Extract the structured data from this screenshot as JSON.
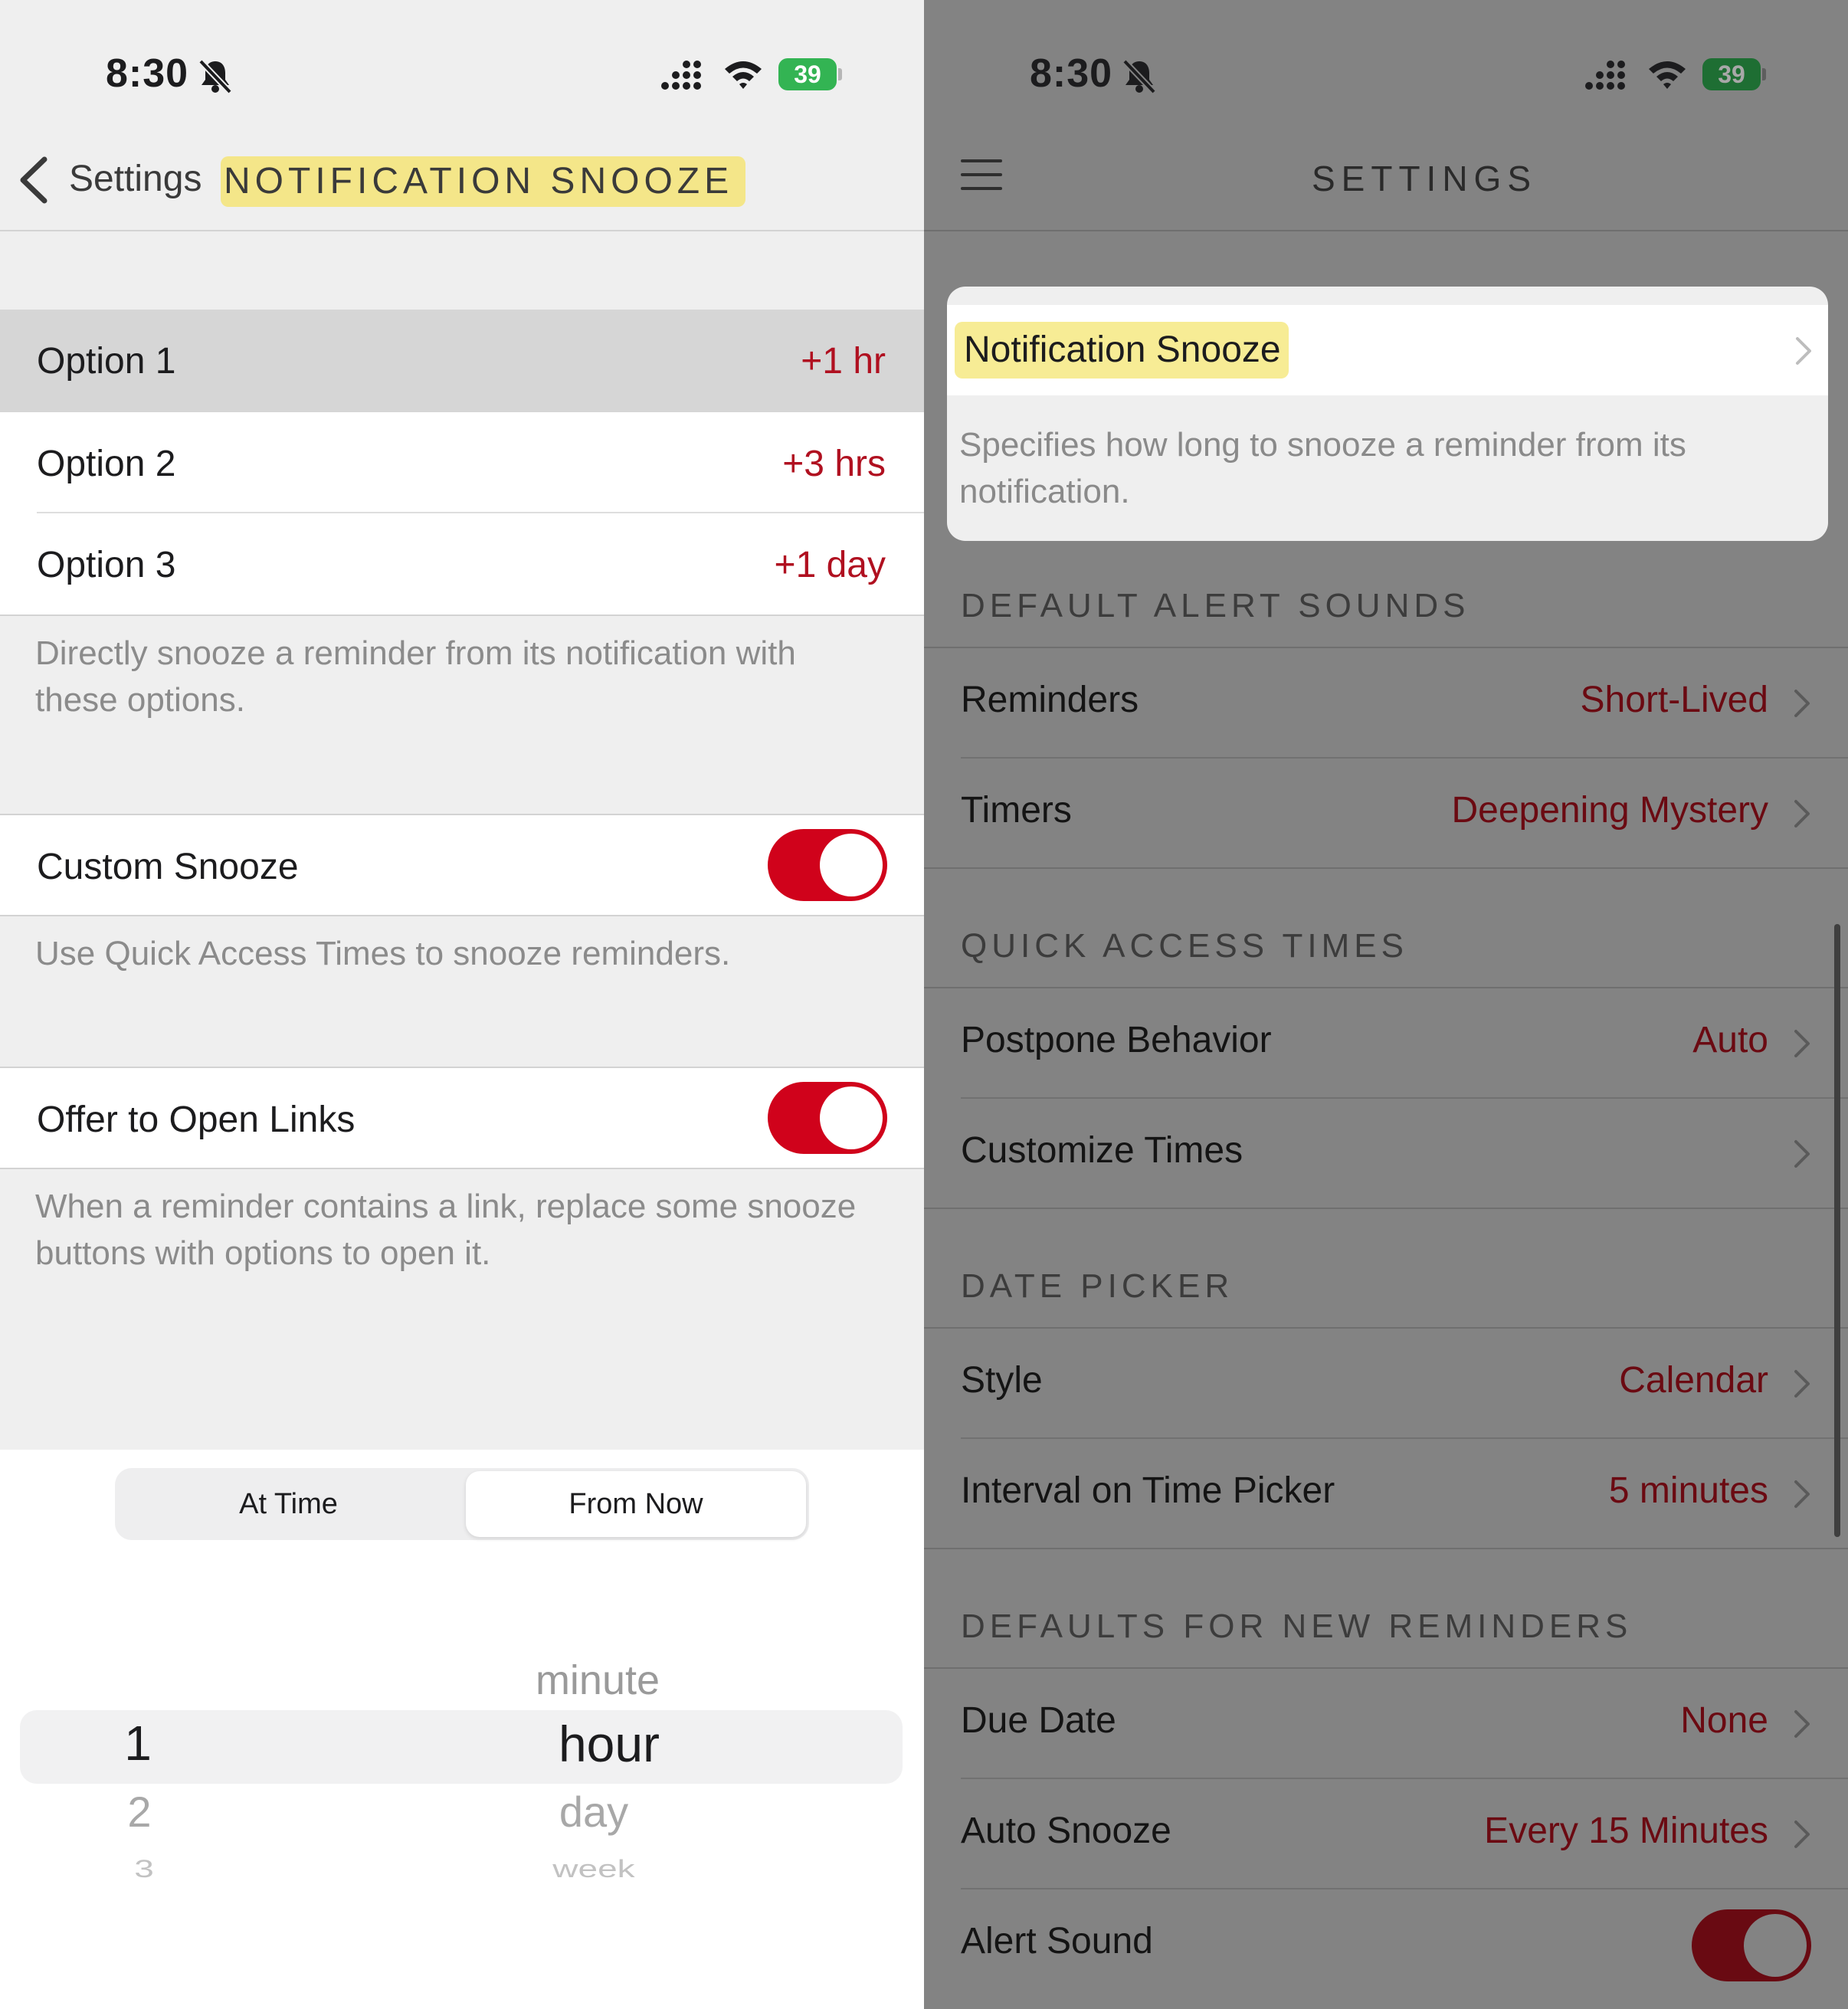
{
  "left": {
    "status": {
      "time": "8:30",
      "battery": "39"
    },
    "nav": {
      "back_label": "Settings",
      "title": "NOTIFICATION SNOOZE"
    },
    "options": [
      {
        "label": "Option 1",
        "value": "+1 hr"
      },
      {
        "label": "Option 2",
        "value": "+3 hrs"
      },
      {
        "label": "Option 3",
        "value": "+1 day"
      }
    ],
    "options_footer": "Directly snooze a reminder from its notification with these options.",
    "custom_snooze": {
      "label": "Custom Snooze",
      "on": true,
      "footer": "Use Quick Access Times to snooze reminders."
    },
    "open_links": {
      "label": "Offer to Open Links",
      "on": true,
      "footer": "When a reminder contains a link, replace some snooze buttons with options to open it."
    },
    "picker": {
      "segments": [
        "At Time",
        "From Now"
      ],
      "selected_segment": "From Now",
      "numbers": [
        "1",
        "2",
        "3"
      ],
      "units_above": "minute",
      "units": [
        "hour",
        "day",
        "week"
      ]
    }
  },
  "right": {
    "status": {
      "time": "8:30",
      "battery": "39"
    },
    "title": "SETTINGS",
    "card": {
      "label": "Notification Snooze",
      "footer": "Specifies how long to snooze a reminder from its notification."
    },
    "sections": [
      {
        "header": "DEFAULT ALERT SOUNDS",
        "rows": [
          {
            "label": "Reminders",
            "value": "Short-Lived"
          },
          {
            "label": "Timers",
            "value": "Deepening Mystery"
          }
        ]
      },
      {
        "header": "QUICK ACCESS TIMES",
        "rows": [
          {
            "label": "Postpone Behavior",
            "value": "Auto"
          },
          {
            "label": "Customize Times",
            "value": ""
          }
        ]
      },
      {
        "header": "DATE PICKER",
        "rows": [
          {
            "label": "Style",
            "value": "Calendar"
          },
          {
            "label": "Interval on Time Picker",
            "value": "5 minutes"
          }
        ]
      },
      {
        "header": "DEFAULTS FOR NEW REMINDERS",
        "rows": [
          {
            "label": "Due Date",
            "value": "None"
          },
          {
            "label": "Auto Snooze",
            "value": "Every 15 Minutes"
          },
          {
            "label": "Alert Sound",
            "toggle": true
          }
        ]
      }
    ]
  },
  "colors": {
    "accent_red": "#d0021b",
    "highlight_yellow": "#f4e689",
    "dim_overlay": "#838383"
  }
}
